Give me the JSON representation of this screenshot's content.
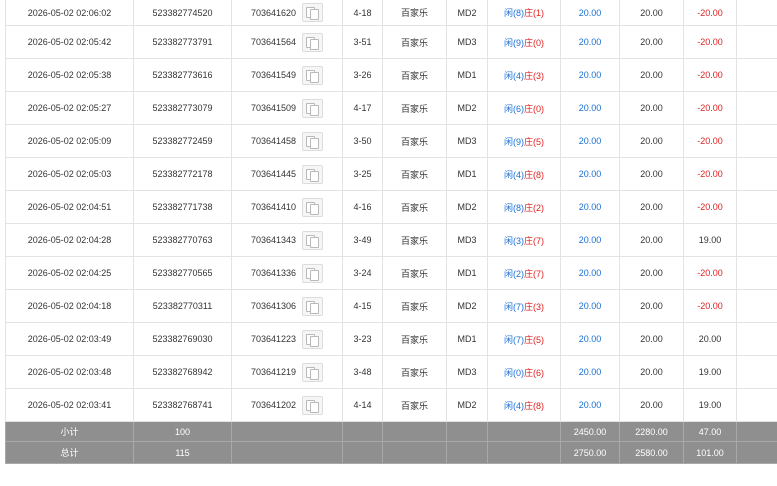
{
  "icons": {
    "detail": "card-detail-icon"
  },
  "colors": {
    "win": "#1a6fd4",
    "loss": "#e02020",
    "player": "#1a6fd4",
    "banker": "#e02020",
    "footer_bg": "#8f8f8f"
  },
  "rows": [
    {
      "time": "2026-05-02 02:06:02",
      "order": "523382774520",
      "game": "703641620",
      "round": "4-18",
      "type": "百家乐",
      "table": "MD2",
      "p_label": "闲",
      "p_val": "(8)",
      "b_label": "庄",
      "b_val": "(1)",
      "bet": "20.00",
      "valid": "20.00",
      "result": "-20.00"
    },
    {
      "time": "2026-05-02 02:05:42",
      "order": "523382773791",
      "game": "703641564",
      "round": "3-51",
      "type": "百家乐",
      "table": "MD3",
      "p_label": "闲",
      "p_val": "(9)",
      "b_label": "庄",
      "b_val": "(0)",
      "bet": "20.00",
      "valid": "20.00",
      "result": "-20.00"
    },
    {
      "time": "2026-05-02 02:05:38",
      "order": "523382773616",
      "game": "703641549",
      "round": "3-26",
      "type": "百家乐",
      "table": "MD1",
      "p_label": "闲",
      "p_val": "(4)",
      "b_label": "庄",
      "b_val": "(3)",
      "bet": "20.00",
      "valid": "20.00",
      "result": "-20.00"
    },
    {
      "time": "2026-05-02 02:05:27",
      "order": "523382773079",
      "game": "703641509",
      "round": "4-17",
      "type": "百家乐",
      "table": "MD2",
      "p_label": "闲",
      "p_val": "(6)",
      "b_label": "庄",
      "b_val": "(0)",
      "bet": "20.00",
      "valid": "20.00",
      "result": "-20.00"
    },
    {
      "time": "2026-05-02 02:05:09",
      "order": "523382772459",
      "game": "703641458",
      "round": "3-50",
      "type": "百家乐",
      "table": "MD3",
      "p_label": "闲",
      "p_val": "(9)",
      "b_label": "庄",
      "b_val": "(5)",
      "bet": "20.00",
      "valid": "20.00",
      "result": "-20.00"
    },
    {
      "time": "2026-05-02 02:05:03",
      "order": "523382772178",
      "game": "703641445",
      "round": "3-25",
      "type": "百家乐",
      "table": "MD1",
      "p_label": "闲",
      "p_val": "(4)",
      "b_label": "庄",
      "b_val": "(8)",
      "bet": "20.00",
      "valid": "20.00",
      "result": "-20.00"
    },
    {
      "time": "2026-05-02 02:04:51",
      "order": "523382771738",
      "game": "703641410",
      "round": "4-16",
      "type": "百家乐",
      "table": "MD2",
      "p_label": "闲",
      "p_val": "(8)",
      "b_label": "庄",
      "b_val": "(2)",
      "bet": "20.00",
      "valid": "20.00",
      "result": "-20.00"
    },
    {
      "time": "2026-05-02 02:04:28",
      "order": "523382770763",
      "game": "703641343",
      "round": "3-49",
      "type": "百家乐",
      "table": "MD3",
      "p_label": "闲",
      "p_val": "(3)",
      "b_label": "庄",
      "b_val": "(7)",
      "bet": "20.00",
      "valid": "20.00",
      "result": "19.00"
    },
    {
      "time": "2026-05-02 02:04:25",
      "order": "523382770565",
      "game": "703641336",
      "round": "3-24",
      "type": "百家乐",
      "table": "MD1",
      "p_label": "闲",
      "p_val": "(2)",
      "b_label": "庄",
      "b_val": "(7)",
      "bet": "20.00",
      "valid": "20.00",
      "result": "-20.00"
    },
    {
      "time": "2026-05-02 02:04:18",
      "order": "523382770311",
      "game": "703641306",
      "round": "4-15",
      "type": "百家乐",
      "table": "MD2",
      "p_label": "闲",
      "p_val": "(7)",
      "b_label": "庄",
      "b_val": "(3)",
      "bet": "20.00",
      "valid": "20.00",
      "result": "-20.00"
    },
    {
      "time": "2026-05-02 02:03:49",
      "order": "523382769030",
      "game": "703641223",
      "round": "3-23",
      "type": "百家乐",
      "table": "MD1",
      "p_label": "闲",
      "p_val": "(7)",
      "b_label": "庄",
      "b_val": "(5)",
      "bet": "20.00",
      "valid": "20.00",
      "result": "20.00"
    },
    {
      "time": "2026-05-02 02:03:48",
      "order": "523382768942",
      "game": "703641219",
      "round": "3-48",
      "type": "百家乐",
      "table": "MD3",
      "p_label": "闲",
      "p_val": "(0)",
      "b_label": "庄",
      "b_val": "(6)",
      "bet": "20.00",
      "valid": "20.00",
      "result": "19.00"
    },
    {
      "time": "2026-05-02 02:03:41",
      "order": "523382768741",
      "game": "703641202",
      "round": "4-14",
      "type": "百家乐",
      "table": "MD2",
      "p_label": "闲",
      "p_val": "(4)",
      "b_label": "庄",
      "b_val": "(8)",
      "bet": "20.00",
      "valid": "20.00",
      "result": "19.00"
    }
  ],
  "subtotal": {
    "label": "小计",
    "count": "100",
    "bet": "2450.00",
    "valid": "2280.00",
    "result": "47.00"
  },
  "total": {
    "label": "总计",
    "count": "115",
    "bet": "2750.00",
    "valid": "2580.00",
    "result": "101.00"
  }
}
